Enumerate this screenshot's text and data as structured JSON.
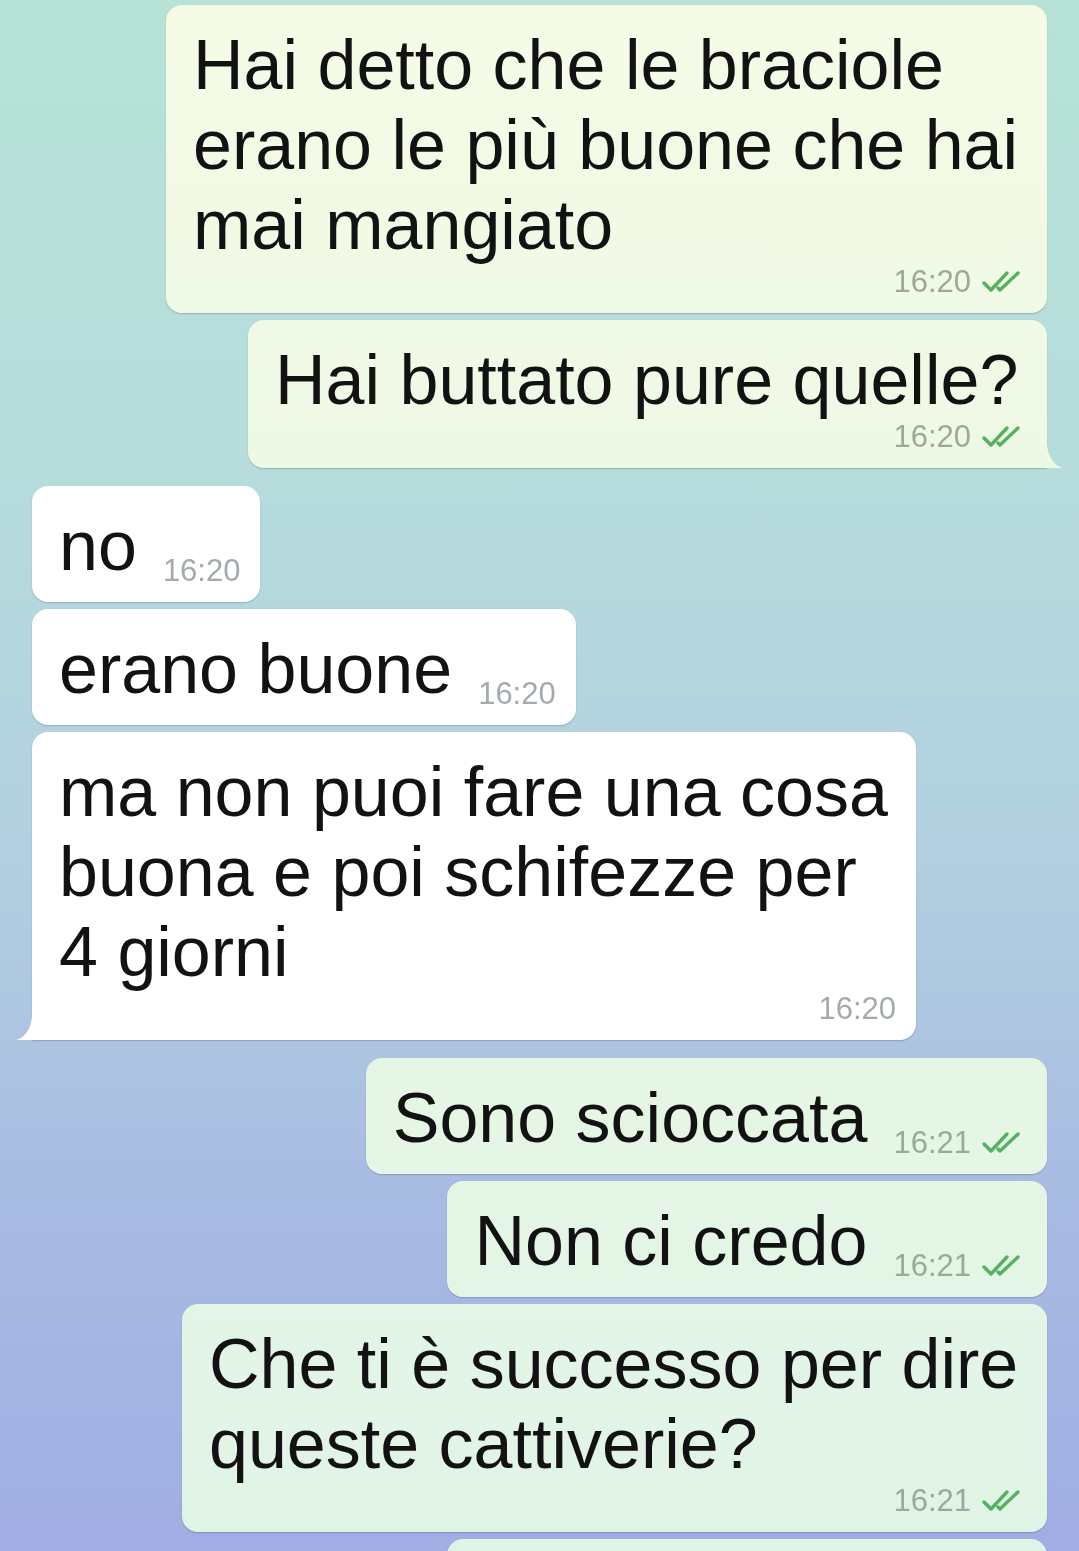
{
  "chat": {
    "messages": [
      {
        "kind": "outgoing",
        "text": "Hai detto che le braciole erano le più buone che hai mai mangiato",
        "time": "16:20",
        "read": true,
        "tail": false
      },
      {
        "kind": "outgoing",
        "text": "Hai buttato pure quelle?",
        "time": "16:20",
        "read": true,
        "tail": true
      },
      {
        "kind": "incoming",
        "text": "no",
        "time": "16:20",
        "tail": false
      },
      {
        "kind": "incoming",
        "text": "erano buone",
        "time": "16:20",
        "tail": false
      },
      {
        "kind": "incoming",
        "text": "ma non puoi fare una cosa buona e poi schifezze per 4 giorni",
        "time": "16:20",
        "tail": true
      },
      {
        "kind": "outgoing",
        "text": "Sono scioccata",
        "time": "16:21",
        "read": true,
        "tail": false
      },
      {
        "kind": "outgoing",
        "text": "Non ci credo",
        "time": "16:21",
        "read": true,
        "tail": false
      },
      {
        "kind": "outgoing",
        "text": "Che ti è successo per dire queste cattiverie?",
        "time": "16:21",
        "read": true,
        "tail": false
      },
      {
        "kind": "outgoing"
      }
    ]
  }
}
